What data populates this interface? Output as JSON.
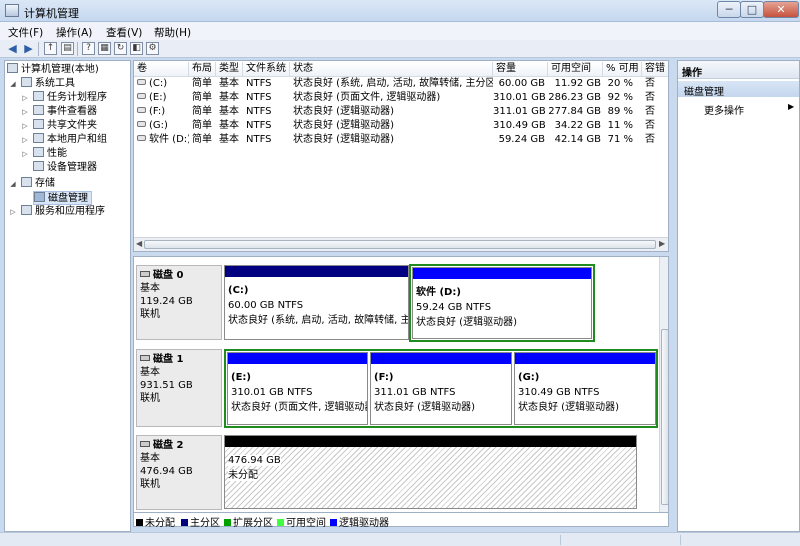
{
  "window": {
    "title": "计算机管理"
  },
  "window_buttons": {
    "minimize": "─",
    "maximize": "□",
    "close": "✕"
  },
  "menu": [
    "文件(F)",
    "操作(A)",
    "查看(V)",
    "帮助(H)"
  ],
  "tree": {
    "root": "计算机管理(本地)",
    "system_tools": "系统工具",
    "task_scheduler": "任务计划程序",
    "event_viewer": "事件查看器",
    "shared_folders": "共享文件夹",
    "local_users": "本地用户和组",
    "performance": "性能",
    "device_manager": "设备管理器",
    "storage": "存储",
    "disk_management": "磁盘管理",
    "services_apps": "服务和应用程序"
  },
  "volume_list": {
    "headers": [
      "卷",
      "布局",
      "类型",
      "文件系统",
      "状态",
      "容量",
      "可用空间",
      "% 可用",
      "容错"
    ],
    "rows": [
      [
        "(C:)",
        "简单",
        "基本",
        "NTFS",
        "状态良好 (系统, 启动, 活动, 故障转储, 主分区)",
        "60.00 GB",
        "11.92 GB",
        "20 %",
        "否"
      ],
      [
        "(E:)",
        "简单",
        "基本",
        "NTFS",
        "状态良好 (页面文件, 逻辑驱动器)",
        "310.01 GB",
        "286.23 GB",
        "92 %",
        "否"
      ],
      [
        "(F:)",
        "简单",
        "基本",
        "NTFS",
        "状态良好 (逻辑驱动器)",
        "311.01 GB",
        "277.84 GB",
        "89 %",
        "否"
      ],
      [
        "(G:)",
        "简单",
        "基本",
        "NTFS",
        "状态良好 (逻辑驱动器)",
        "310.49 GB",
        "34.22 GB",
        "11 %",
        "否"
      ],
      [
        "软件 (D:)",
        "简单",
        "基本",
        "NTFS",
        "状态良好 (逻辑驱动器)",
        "59.24 GB",
        "42.14 GB",
        "71 %",
        "否"
      ]
    ]
  },
  "disks": [
    {
      "name": "磁盘 0",
      "type": "基本",
      "size": "119.24 GB",
      "status": "联机",
      "partitions": [
        {
          "letter": "(C:)",
          "size": "60.00 GB NTFS",
          "status": "状态良好 (系统, 启动, 活动, 故障转储, 主"
        },
        {
          "letter": "软件  (D:)",
          "size": "59.24 GB NTFS",
          "status": "状态良好 (逻辑驱动器)"
        }
      ]
    },
    {
      "name": "磁盘 1",
      "type": "基本",
      "size": "931.51 GB",
      "status": "联机",
      "partitions": [
        {
          "letter": "(E:)",
          "size": "310.01 GB NTFS",
          "status": "状态良好 (页面文件, 逻辑驱动器"
        },
        {
          "letter": "(F:)",
          "size": "311.01 GB NTFS",
          "status": "状态良好 (逻辑驱动器)"
        },
        {
          "letter": "(G:)",
          "size": "310.49 GB NTFS",
          "status": "状态良好 (逻辑驱动器)"
        }
      ]
    },
    {
      "name": "磁盘 2",
      "type": "基本",
      "size": "476.94 GB",
      "status": "联机",
      "partitions": [
        {
          "size": "476.94 GB",
          "status": "未分配"
        }
      ]
    }
  ],
  "legend": [
    {
      "label": "未分配",
      "color": "#000000"
    },
    {
      "label": "主分区",
      "color": "#000080"
    },
    {
      "label": "扩展分区",
      "color": "#00a000"
    },
    {
      "label": "可用空间",
      "color": "#40ff40"
    },
    {
      "label": "逻辑驱动器",
      "color": "#0000ff"
    }
  ],
  "actions": {
    "title": "操作",
    "section": "磁盘管理",
    "more": "更多操作"
  },
  "colors": {
    "primary": "#000080",
    "logical": "#0000ff",
    "unallocated": "#000000",
    "extended_border": "#1f8c1f"
  }
}
